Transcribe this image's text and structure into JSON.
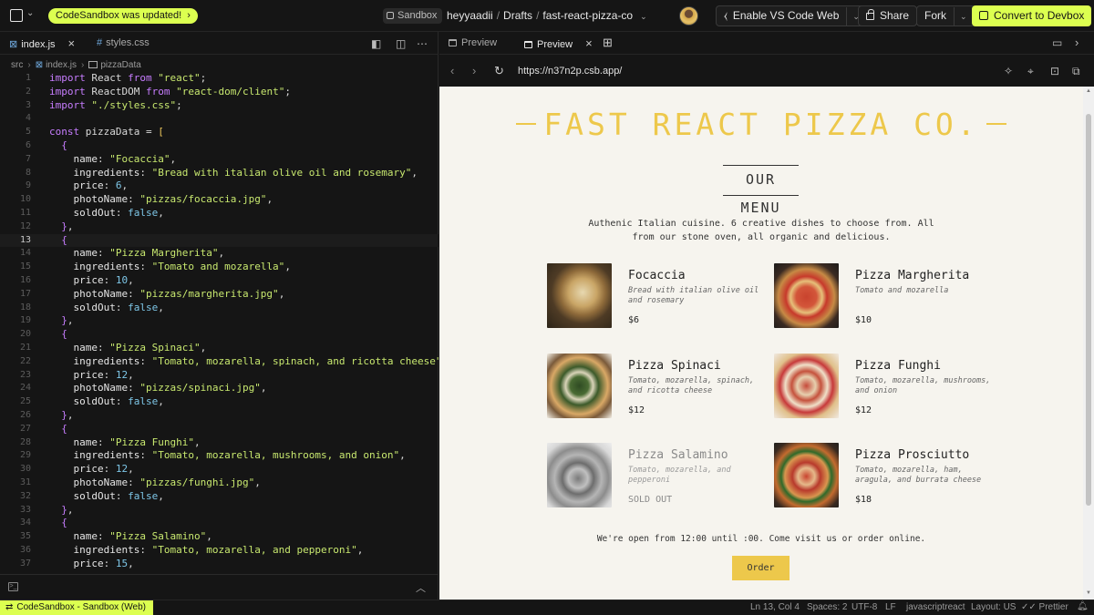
{
  "topbar": {
    "updated_label": "CodeSandbox was updated!",
    "updated_arrow": "›",
    "sandbox_badge": "Sandbox",
    "path": {
      "user": "heyyaadii",
      "folder": "Drafts",
      "project": "fast-react-pizza-co"
    },
    "vscode_label": "Enable VS Code Web",
    "share_label": "Share",
    "fork_label": "Fork",
    "convert_label": "Convert to Devbox",
    "accent_color": "#dcff50"
  },
  "editor": {
    "tabs": [
      {
        "label": "index.js",
        "active": true
      },
      {
        "label": "styles.css",
        "active": false
      }
    ],
    "breadcrumb": {
      "folder": "src",
      "file": "index.js",
      "symbol": "pizzaData"
    },
    "current_line": 13,
    "lines": [
      {
        "n": "1",
        "html": "<span class=\"kw\">import</span> React <span class=\"kw\">from</span> <span class=\"str\">\"react\"</span>;"
      },
      {
        "n": "2",
        "html": "<span class=\"kw\">import</span> ReactDOM <span class=\"kw\">from</span> <span class=\"str\">\"react-dom/client\"</span>;"
      },
      {
        "n": "3",
        "html": "<span class=\"kw\">import</span> <span class=\"str\">\"./styles.css\"</span>;"
      },
      {
        "n": "4",
        "html": ""
      },
      {
        "n": "5",
        "html": "<span class=\"kw\">const</span> pizzaData = <span class=\"br1\">[</span>"
      },
      {
        "n": "6",
        "html": "  <span class=\"br2\">{</span>"
      },
      {
        "n": "7",
        "html": "    <span class=\"key\">name</span>: <span class=\"str\">\"Focaccia\"</span>,"
      },
      {
        "n": "8",
        "html": "    <span class=\"key\">ingredients</span>: <span class=\"str\">\"Bread with italian olive oil and rosemary\"</span>,"
      },
      {
        "n": "9",
        "html": "    <span class=\"key\">price</span>: <span class=\"num\">6</span>,"
      },
      {
        "n": "10",
        "html": "    <span class=\"key\">photoName</span>: <span class=\"str\">\"pizzas/focaccia.jpg\"</span>,"
      },
      {
        "n": "11",
        "html": "    <span class=\"key\">soldOut</span>: <span class=\"bool\">false</span>,"
      },
      {
        "n": "12",
        "html": "  <span class=\"br2\">}</span>,"
      },
      {
        "n": "13",
        "html": "  <span class=\"br2\">{</span>"
      },
      {
        "n": "14",
        "html": "    <span class=\"key\">name</span>: <span class=\"str\">\"Pizza Margherita\"</span>,"
      },
      {
        "n": "15",
        "html": "    <span class=\"key\">ingredients</span>: <span class=\"str\">\"Tomato and mozarella\"</span>,"
      },
      {
        "n": "16",
        "html": "    <span class=\"key\">price</span>: <span class=\"num\">10</span>,"
      },
      {
        "n": "17",
        "html": "    <span class=\"key\">photoName</span>: <span class=\"str\">\"pizzas/margherita.jpg\"</span>,"
      },
      {
        "n": "18",
        "html": "    <span class=\"key\">soldOut</span>: <span class=\"bool\">false</span>,"
      },
      {
        "n": "19",
        "html": "  <span class=\"br2\">}</span>,"
      },
      {
        "n": "20",
        "html": "  <span class=\"br2\">{</span>"
      },
      {
        "n": "21",
        "html": "    <span class=\"key\">name</span>: <span class=\"str\">\"Pizza Spinaci\"</span>,"
      },
      {
        "n": "22",
        "html": "    <span class=\"key\">ingredients</span>: <span class=\"str\">\"Tomato, mozarella, spinach, and ricotta cheese\"</span>,"
      },
      {
        "n": "23",
        "html": "    <span class=\"key\">price</span>: <span class=\"num\">12</span>,"
      },
      {
        "n": "24",
        "html": "    <span class=\"key\">photoName</span>: <span class=\"str\">\"pizzas/spinaci.jpg\"</span>,"
      },
      {
        "n": "25",
        "html": "    <span class=\"key\">soldOut</span>: <span class=\"bool\">false</span>,"
      },
      {
        "n": "26",
        "html": "  <span class=\"br2\">}</span>,"
      },
      {
        "n": "27",
        "html": "  <span class=\"br2\">{</span>"
      },
      {
        "n": "28",
        "html": "    <span class=\"key\">name</span>: <span class=\"str\">\"Pizza Funghi\"</span>,"
      },
      {
        "n": "29",
        "html": "    <span class=\"key\">ingredients</span>: <span class=\"str\">\"Tomato, mozarella, mushrooms, and onion\"</span>,"
      },
      {
        "n": "30",
        "html": "    <span class=\"key\">price</span>: <span class=\"num\">12</span>,"
      },
      {
        "n": "31",
        "html": "    <span class=\"key\">photoName</span>: <span class=\"str\">\"pizzas/funghi.jpg\"</span>,"
      },
      {
        "n": "32",
        "html": "    <span class=\"key\">soldOut</span>: <span class=\"bool\">false</span>,"
      },
      {
        "n": "33",
        "html": "  <span class=\"br2\">}</span>,"
      },
      {
        "n": "34",
        "html": "  <span class=\"br2\">{</span>"
      },
      {
        "n": "35",
        "html": "    <span class=\"key\">name</span>: <span class=\"str\">\"Pizza Salamino\"</span>,"
      },
      {
        "n": "36",
        "html": "    <span class=\"key\">ingredients</span>: <span class=\"str\">\"Tomato, mozarella, and pepperoni\"</span>,"
      },
      {
        "n": "37",
        "html": "    <span class=\"key\">price</span>: <span class=\"num\">15</span>,"
      }
    ]
  },
  "preview": {
    "tabs": [
      {
        "label": "Preview",
        "active": false
      },
      {
        "label": "Preview",
        "active": true
      }
    ],
    "url": "https://n37n2p.csb.app/",
    "site": {
      "title": "FAST REACT PIZZA CO.",
      "menu_heading": "OUR MENU",
      "intro": "Authenic Italian cuisine. 6 creative dishes to choose from. All from our stone oven, all organic and delicious.",
      "pizzas": [
        {
          "name": "Focaccia",
          "ingredients": "Bread with italian olive oil and rosemary",
          "price": "$6",
          "sold_out": false,
          "img": "img-focaccia"
        },
        {
          "name": "Pizza Margherita",
          "ingredients": "Tomato and mozarella",
          "price": "$10",
          "sold_out": false,
          "img": "img-margherita"
        },
        {
          "name": "Pizza Spinaci",
          "ingredients": "Tomato, mozarella, spinach, and ricotta cheese",
          "price": "$12",
          "sold_out": false,
          "img": "img-spinaci"
        },
        {
          "name": "Pizza Funghi",
          "ingredients": "Tomato, mozarella, mushrooms, and onion",
          "price": "$12",
          "sold_out": false,
          "img": "img-funghi"
        },
        {
          "name": "Pizza Salamino",
          "ingredients": "Tomato, mozarella, and pepperoni",
          "price": "SOLD OUT",
          "sold_out": true,
          "img": "img-salamino"
        },
        {
          "name": "Pizza Prosciutto",
          "ingredients": "Tomato, mozarella, ham, aragula, and burrata cheese",
          "price": "$18",
          "sold_out": false,
          "img": "img-prosciutto"
        }
      ],
      "open_text": "We're open from 12:00 until :00. Come visit us or order online.",
      "order_label": "Order",
      "brand_color": "#edc84b"
    }
  },
  "status": {
    "left_label": "CodeSandbox - Sandbox (Web)",
    "position": "Ln 13, Col 4",
    "spaces": "Spaces: 2",
    "encoding": "UTF-8",
    "eol": "LF",
    "language": "javascriptreact",
    "layout": "Layout: US",
    "formatter": "Prettier"
  }
}
